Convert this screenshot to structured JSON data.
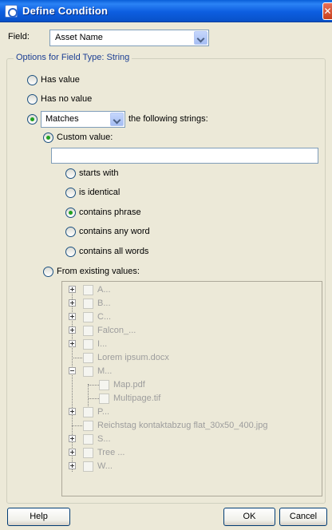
{
  "window": {
    "title": "Define Condition",
    "close_symbol": "✕"
  },
  "field": {
    "label": "Field:",
    "value": "Asset Name"
  },
  "options_group": {
    "legend": "Options for Field Type: String"
  },
  "value_mode": {
    "has_value": "Has value",
    "has_no_value": "Has no value",
    "match_operator": "Matches",
    "following_strings": "the following strings:"
  },
  "custom": {
    "label": "Custom value:",
    "input_value": "",
    "options": [
      "starts with",
      "is identical",
      "contains phrase",
      "contains any word",
      "contains all words"
    ],
    "selected_option": "contains phrase"
  },
  "existing": {
    "label": "From existing values:",
    "tree": [
      {
        "text": "A...",
        "expander": "plus"
      },
      {
        "text": "B...",
        "expander": "plus"
      },
      {
        "text": "C...",
        "expander": "plus"
      },
      {
        "text": "Falcon_...",
        "expander": "plus"
      },
      {
        "text": "I...",
        "expander": "plus"
      },
      {
        "text": "Lorem ipsum.docx",
        "expander": "none"
      },
      {
        "text": "M...",
        "expander": "minus"
      },
      {
        "text": "Map.pdf",
        "expander": "child"
      },
      {
        "text": "Multipage.tif",
        "expander": "child"
      },
      {
        "text": "P...",
        "expander": "plus"
      },
      {
        "text": "Reichstag kontaktabzug flat_30x50_400.jpg",
        "expander": "none"
      },
      {
        "text": "S...",
        "expander": "plus"
      },
      {
        "text": "Tree ...",
        "expander": "plus"
      },
      {
        "text": "W...",
        "expander": "plus"
      }
    ]
  },
  "buttons": {
    "help": "Help",
    "ok": "OK",
    "cancel": "Cancel"
  }
}
